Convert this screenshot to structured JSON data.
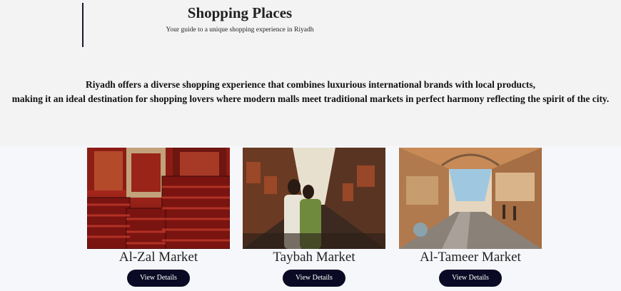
{
  "header": {
    "title": "Shopping Places",
    "subtitle": "Your guide to a unique shopping experience in Riyadh"
  },
  "intro": {
    "line1": "Riyadh offers a diverse shopping experience that combines luxurious international brands with local products,",
    "line2": "making it an ideal destination for shopping lovers where modern malls meet traditional markets in perfect harmony reflecting the spirit of the city."
  },
  "markets": [
    {
      "name": "Al-Zal Market",
      "button": "View Details",
      "image": "carpets-stall-photo"
    },
    {
      "name": "Taybah Market",
      "button": "View Details",
      "image": "market-alley-couple-photo"
    },
    {
      "name": "Al-Tameer Market",
      "button": "View Details",
      "image": "market-street-photo"
    }
  ],
  "colors": {
    "button_bg": "#0a0a24",
    "button_text": "#ffffff",
    "page_bg": "#f3f3f4"
  }
}
